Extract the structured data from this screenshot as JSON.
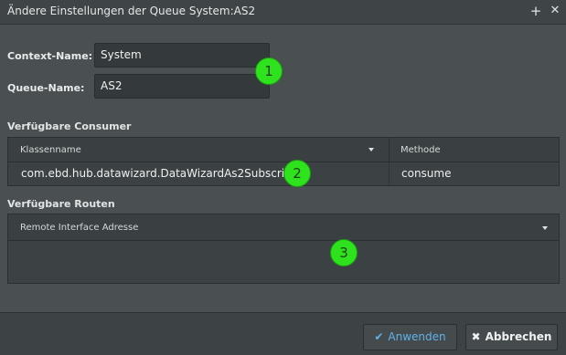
{
  "window": {
    "title": "Ändere Einstellungen der Queue System:AS2",
    "add_glyph": "+",
    "close_glyph": "✕"
  },
  "form": {
    "context_label": "Context-Name:",
    "context_value": "System",
    "queue_label": "Queue-Name:",
    "queue_value": "AS2"
  },
  "consumers": {
    "section_label": "Verfügbare Consumer",
    "columns": [
      "Klassenname",
      "Methode"
    ],
    "rows": [
      [
        "com.ebd.hub.datawizard.DataWizardAs2Subscriber",
        "consume"
      ]
    ]
  },
  "routes": {
    "section_label": "Verfügbare Routen",
    "columns": [
      "Remote Interface Adresse"
    ]
  },
  "markers": [
    "1",
    "2",
    "3"
  ],
  "footer": {
    "apply_label": "Anwenden",
    "apply_icon": "check-icon",
    "cancel_label": "Abbrechen",
    "cancel_icon": "close-icon"
  },
  "colors": {
    "accent": "#5fb2e8",
    "marker": "#2fe21e"
  }
}
